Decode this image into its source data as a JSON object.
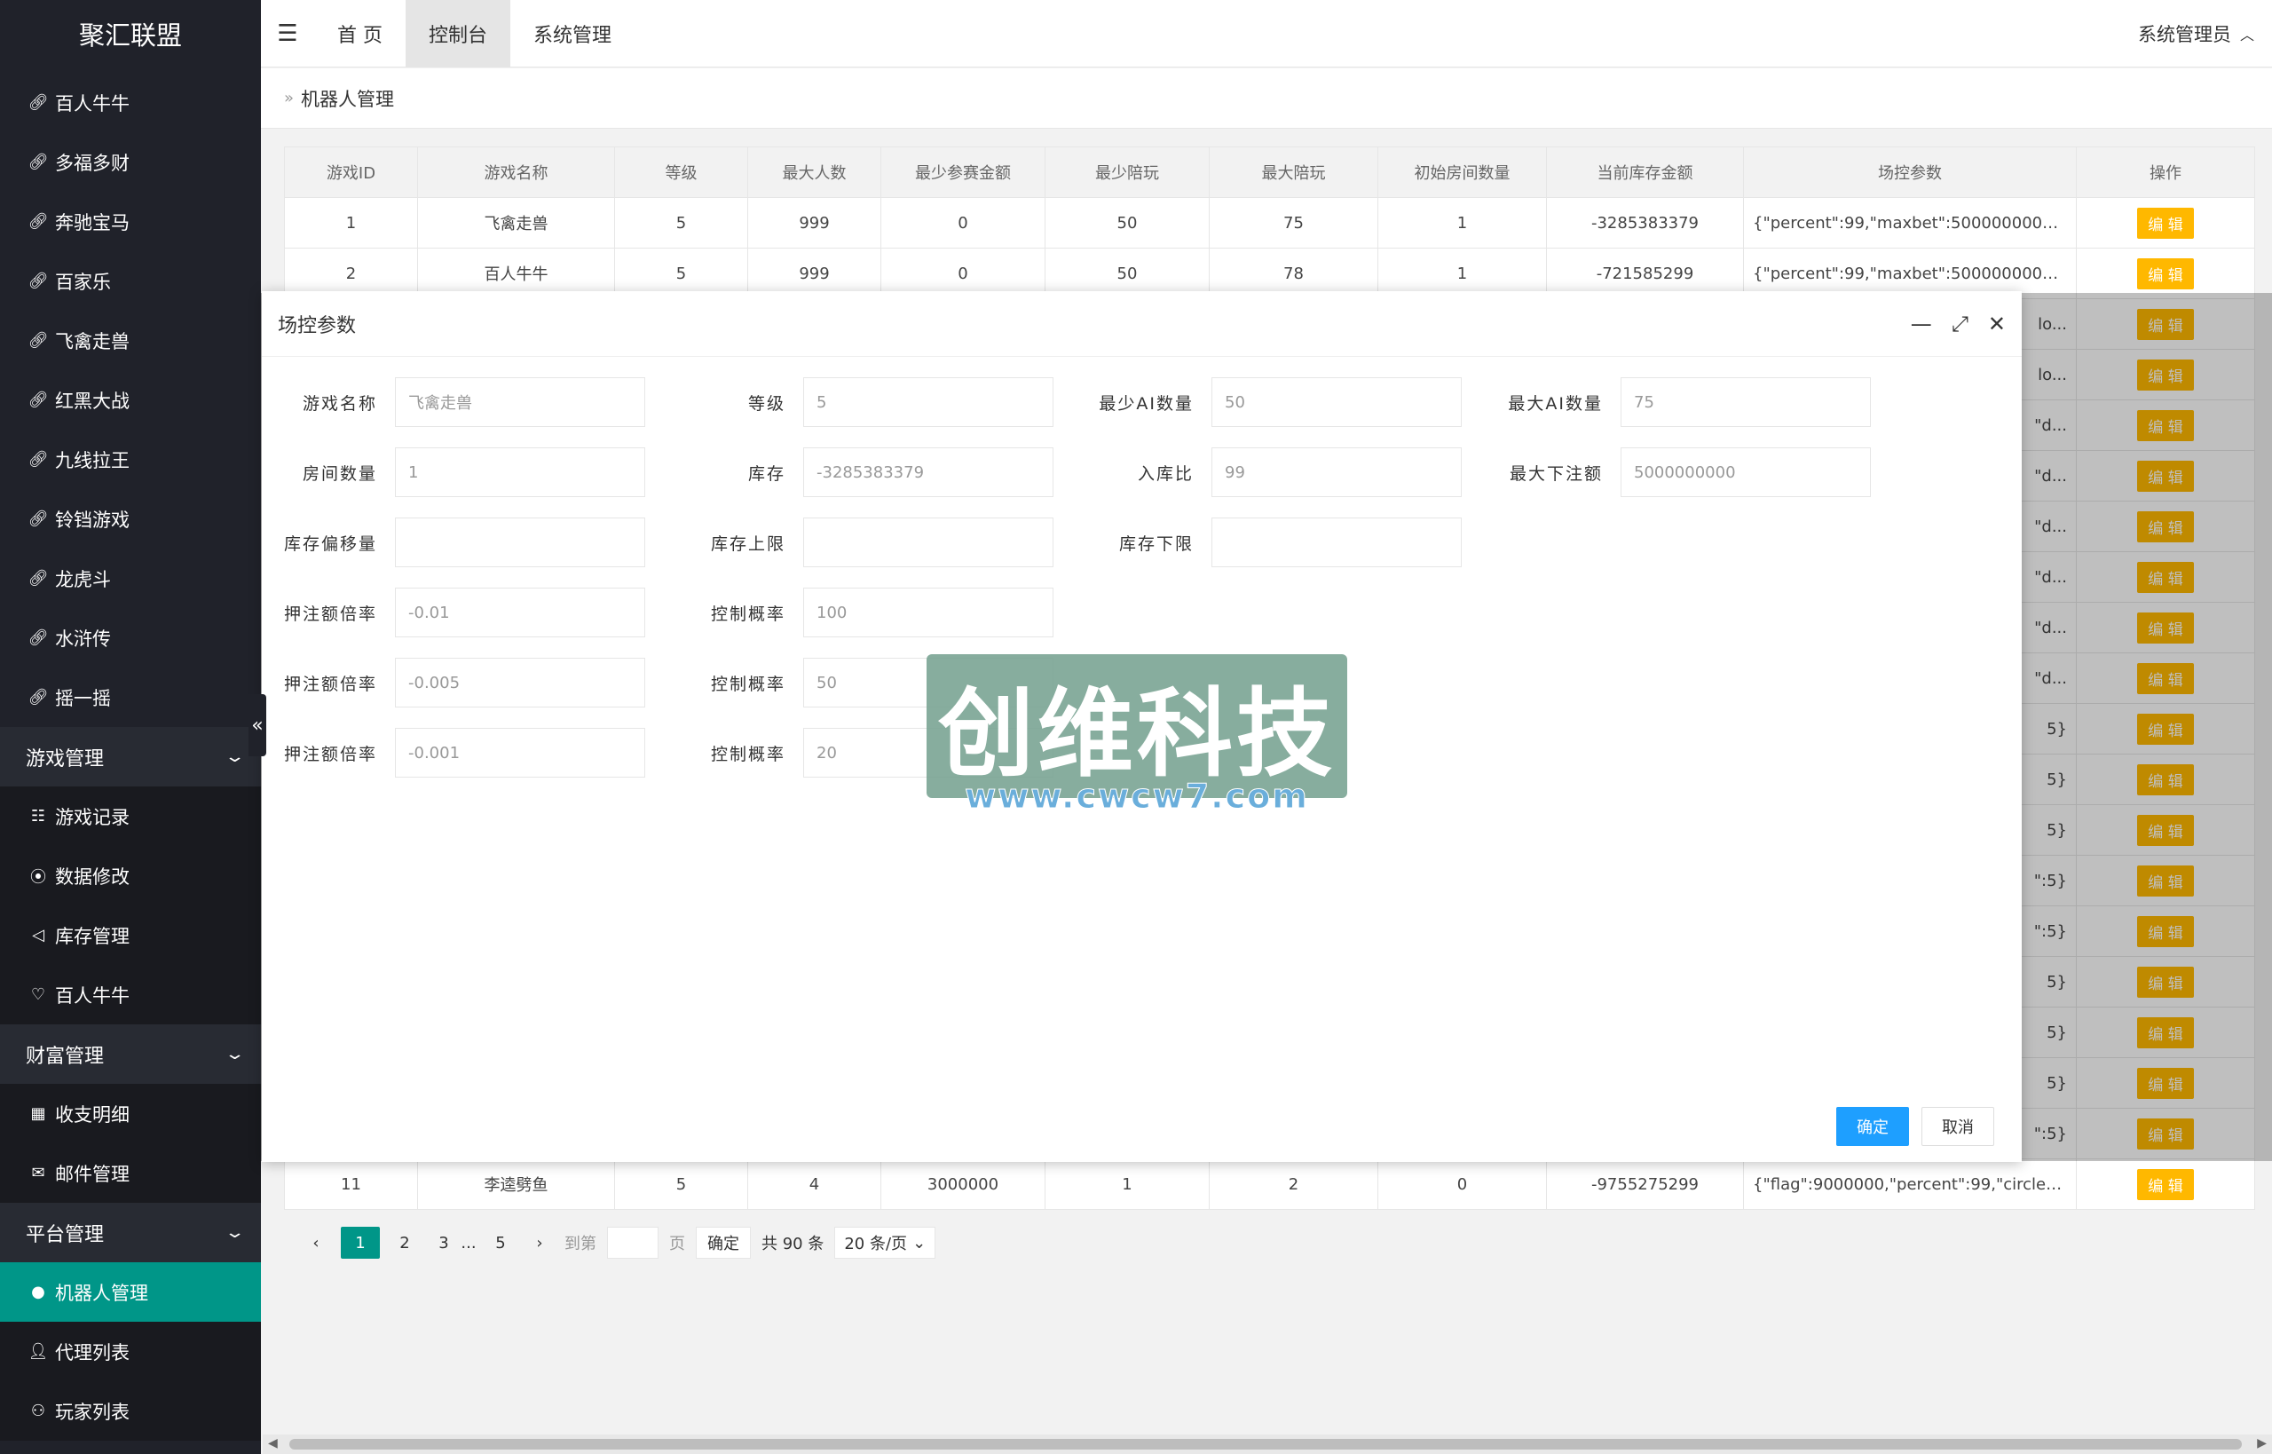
{
  "app": {
    "title": "聚汇联盟"
  },
  "sidebar": {
    "items": [
      {
        "label": "百人牛牛",
        "icon": "link-icon"
      },
      {
        "label": "多福多财",
        "icon": "link-icon"
      },
      {
        "label": "奔驰宝马",
        "icon": "link-icon"
      },
      {
        "label": "百家乐",
        "icon": "link-icon"
      },
      {
        "label": "飞禽走兽",
        "icon": "link-icon"
      },
      {
        "label": "红黑大战",
        "icon": "link-icon"
      },
      {
        "label": "九线拉王",
        "icon": "link-icon"
      },
      {
        "label": "铃铛游戏",
        "icon": "link-icon"
      },
      {
        "label": "龙虎斗",
        "icon": "link-icon"
      },
      {
        "label": "水浒传",
        "icon": "link-icon"
      },
      {
        "label": "摇一摇",
        "icon": "link-icon"
      }
    ],
    "group_game": {
      "label": "游戏管理",
      "items": [
        {
          "label": "游戏记录",
          "icon": "list-icon"
        },
        {
          "label": "数据修改",
          "icon": "broadcast-icon"
        },
        {
          "label": "库存管理",
          "icon": "send-icon"
        },
        {
          "label": "百人牛牛",
          "icon": "heart-icon"
        }
      ]
    },
    "group_wealth": {
      "label": "财富管理",
      "items": [
        {
          "label": "收支明细",
          "icon": "calendar-icon"
        },
        {
          "label": "邮件管理",
          "icon": "mail-icon"
        }
      ]
    },
    "group_platform": {
      "label": "平台管理",
      "items": [
        {
          "label": "机器人管理",
          "icon": "android-icon"
        },
        {
          "label": "代理列表",
          "icon": "user-icon"
        },
        {
          "label": "玩家列表",
          "icon": "user-outline-icon"
        }
      ]
    }
  },
  "header": {
    "nav": [
      "首 页",
      "控制台",
      "系统管理"
    ],
    "user": "系统管理员"
  },
  "breadcrumb": {
    "current": "机器人管理"
  },
  "table": {
    "columns": [
      "游戏ID",
      "游戏名称",
      "等级",
      "最大人数",
      "最少参赛金额",
      "最少陪玩",
      "最大陪玩",
      "初始房间数量",
      "当前库存金额",
      "场控参数",
      "操作"
    ],
    "rows": [
      [
        "1",
        "飞禽走兽",
        "5",
        "999",
        "0",
        "50",
        "75",
        "1",
        "-3285383379",
        "{\"percent\":99,\"maxbet\":5000000000,\"d...",
        "编 辑"
      ],
      [
        "2",
        "百人牛牛",
        "5",
        "999",
        "0",
        "50",
        "78",
        "1",
        "-721585299",
        "{\"percent\":99,\"maxbet\":5000000000,\"d...",
        "编 辑"
      ]
    ],
    "last_row": [
      "11",
      "李逵劈鱼",
      "5",
      "4",
      "3000000",
      "1",
      "2",
      "0",
      "-9755275299",
      "{\"flag\":9000000,\"percent\":99,\"circle\":5}",
      "编 辑"
    ],
    "hidden_param_tails": [
      "lo...",
      "lo...",
      "\"d...",
      "\"d...",
      "\"d...",
      "\"d...",
      "\"d...",
      "\"d...",
      "5}",
      "5}",
      "5}",
      "\":5}",
      "\":5}",
      "5}",
      "5}",
      "5}",
      "\":5}"
    ],
    "edit_label": "编 辑"
  },
  "pager": {
    "pages": [
      "1",
      "2",
      "3",
      "...",
      "5"
    ],
    "goto_label": "到第",
    "page_unit": "页",
    "confirm": "确定",
    "total": "共 90 条",
    "page_size": "20 条/页"
  },
  "modal": {
    "title": "场控参数",
    "fields": {
      "game_name": {
        "label": "游戏名称",
        "value": "飞禽走兽"
      },
      "level": {
        "label": "等级",
        "value": "5"
      },
      "min_ai": {
        "label": "最少AI数量",
        "value": "50"
      },
      "max_ai": {
        "label": "最大AI数量",
        "value": "75"
      },
      "room_count": {
        "label": "房间数量",
        "value": "1"
      },
      "stock": {
        "label": "库存",
        "value": "-3285383379"
      },
      "in_ratio": {
        "label": "入库比",
        "value": "99"
      },
      "max_bet": {
        "label": "最大下注额",
        "value": "5000000000"
      },
      "stock_offset": {
        "label": "库存偏移量",
        "value": ""
      },
      "stock_upper": {
        "label": "库存上限",
        "value": ""
      },
      "stock_lower": {
        "label": "库存下限",
        "value": ""
      },
      "bet_rate_1": {
        "label": "押注额倍率",
        "value": "-0.01"
      },
      "ctrl_prob_1": {
        "label": "控制概率",
        "value": "100"
      },
      "bet_rate_2": {
        "label": "押注额倍率",
        "value": "-0.005"
      },
      "ctrl_prob_2": {
        "label": "控制概率",
        "value": "50"
      },
      "bet_rate_3": {
        "label": "押注额倍率",
        "value": "-0.001"
      },
      "ctrl_prob_3": {
        "label": "控制概率",
        "value": "20"
      }
    },
    "ok": "确定",
    "cancel": "取消"
  },
  "watermark": {
    "main": "创维科技",
    "sub": "www.cwcw7.com"
  },
  "colors": {
    "sidebar": "#20222a",
    "active": "#009688",
    "edit": "#ffb800",
    "primary": "#1e9fff"
  }
}
